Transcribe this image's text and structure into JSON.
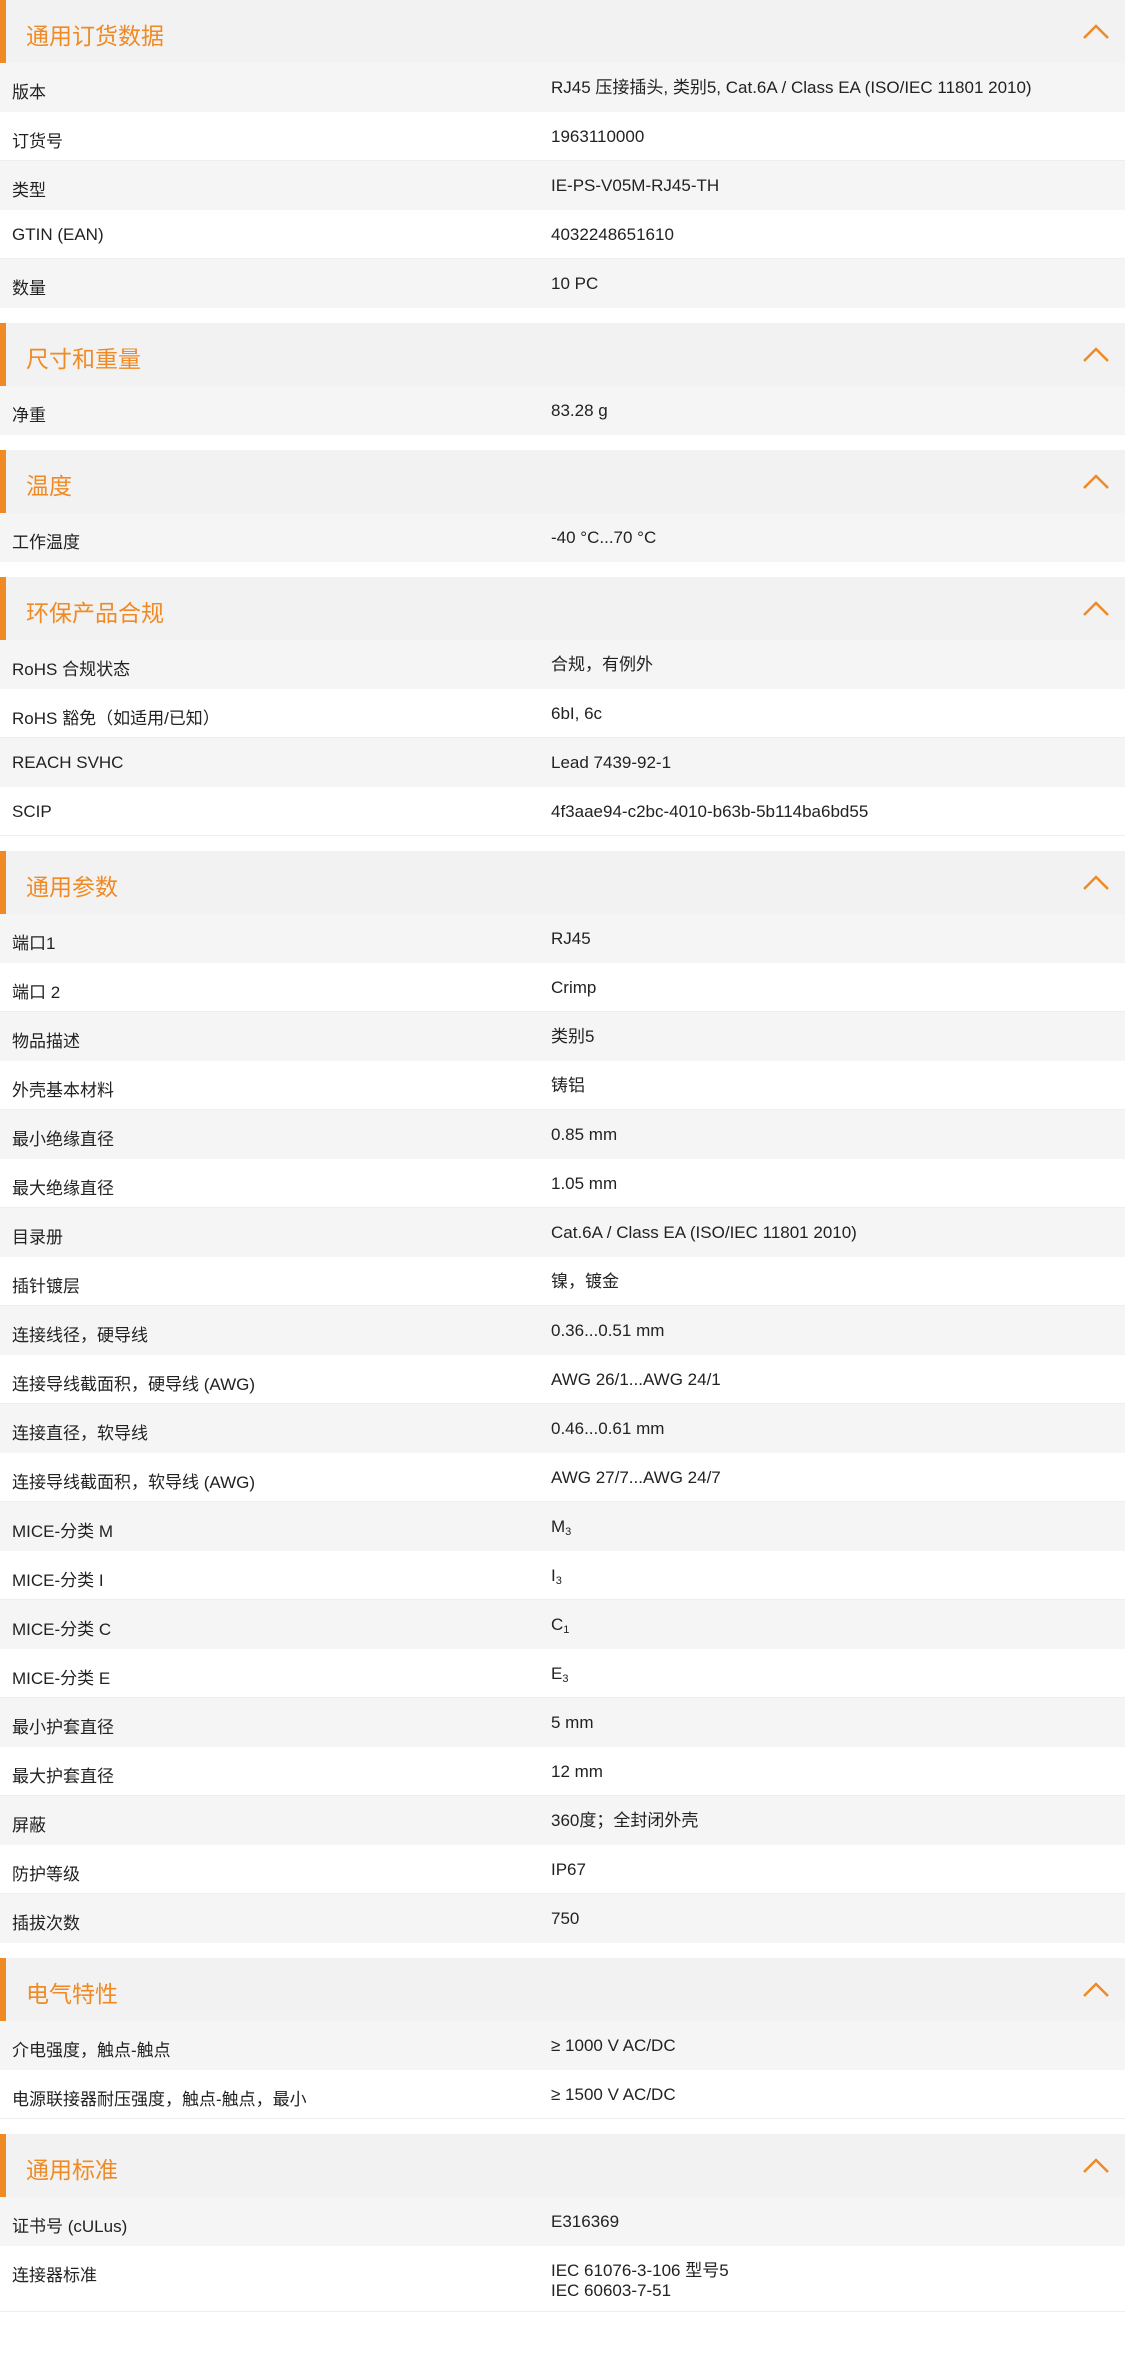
{
  "accent_color": "#f08a24",
  "header_bg": "#f2f2f2",
  "row_bg_alt": "#f5f5f5",
  "collapse_icon": "chevron-up-icon",
  "sections": [
    {
      "title": "通用订货数据",
      "rows": [
        {
          "label": "版本",
          "value": "RJ45 压接插头, 类别5, Cat.6A / Class EA (ISO/IEC 11801 2010)"
        },
        {
          "label": "订货号",
          "value": "1963110000"
        },
        {
          "label": "类型",
          "value": "IE-PS-V05M-RJ45-TH"
        },
        {
          "label": "GTIN (EAN)",
          "value": "4032248651610"
        },
        {
          "label": "数量",
          "value": "10  PC"
        }
      ]
    },
    {
      "title": "尺寸和重量",
      "rows": [
        {
          "label": "净重",
          "value": "83.28  g"
        }
      ]
    },
    {
      "title": "温度",
      "rows": [
        {
          "label": "工作温度",
          "value": "-40 °C...70 °C"
        }
      ]
    },
    {
      "title": "环保产品合规",
      "rows": [
        {
          "label": "RoHS 合规状态",
          "value": "合规，有例外"
        },
        {
          "label": "RoHS 豁免（如适用/已知）",
          "value": "6bI, 6c"
        },
        {
          "label": "REACH SVHC",
          "value": "Lead 7439-92-1"
        },
        {
          "label": "SCIP",
          "value": "4f3aae94-c2bc-4010-b63b-5b114ba6bd55"
        }
      ]
    },
    {
      "title": "通用参数",
      "rows": [
        {
          "label": "端口1",
          "value": "RJ45"
        },
        {
          "label": "端口 2",
          "value": "Crimp"
        },
        {
          "label": "物品描述",
          "value": "类别5"
        },
        {
          "label": "外壳基本材料",
          "value": "铸铝"
        },
        {
          "label": "最小绝缘直径",
          "value": "0.85  mm"
        },
        {
          "label": "最大绝缘直径",
          "value": "1.05  mm"
        },
        {
          "label": "目录册",
          "value": "Cat.6A / Class EA (ISO/IEC 11801 2010)"
        },
        {
          "label": "插针镀层",
          "value": "镍，镀金"
        },
        {
          "label": "连接线径，硬导线",
          "value": "0.36...0.51 mm"
        },
        {
          "label": "连接导线截面积，硬导线 (AWG)",
          "value": "AWG 26/1...AWG 24/1"
        },
        {
          "label": "连接直径，软导线",
          "value": "0.46...0.61 mm"
        },
        {
          "label": "连接导线截面积，软导线 (AWG)",
          "value": "AWG 27/7...AWG 24/7"
        },
        {
          "label": "MICE-分类 M",
          "value": "M",
          "sub": "3"
        },
        {
          "label": "MICE-分类 I",
          "value": "I",
          "sub": "3"
        },
        {
          "label": "MICE-分类 C",
          "value": "C",
          "sub": "1"
        },
        {
          "label": "MICE-分类 E",
          "value": "E",
          "sub": "3"
        },
        {
          "label": "最小护套直径",
          "value": "5  mm"
        },
        {
          "label": "最大护套直径",
          "value": "12  mm"
        },
        {
          "label": "屏蔽",
          "value": "360度；全封闭外壳"
        },
        {
          "label": "防护等级",
          "value": "IP67"
        },
        {
          "label": "插拔次数",
          "value": "750"
        }
      ]
    },
    {
      "title": "电气特性",
      "rows": [
        {
          "label": "介电强度，触点-触点",
          "value": "≥ 1000 V AC/DC"
        },
        {
          "label": "电源联接器耐压强度，触点-触点，最小",
          "value": "≥ 1500 V AC/DC"
        }
      ]
    },
    {
      "title": "通用标准",
      "rows": [
        {
          "label": "证书号 (cULus)",
          "value": "E316369"
        },
        {
          "label": "连接器标准",
          "value": "IEC 61076-3-106 型号5",
          "value2": "IEC 60603-7-51"
        }
      ]
    }
  ]
}
